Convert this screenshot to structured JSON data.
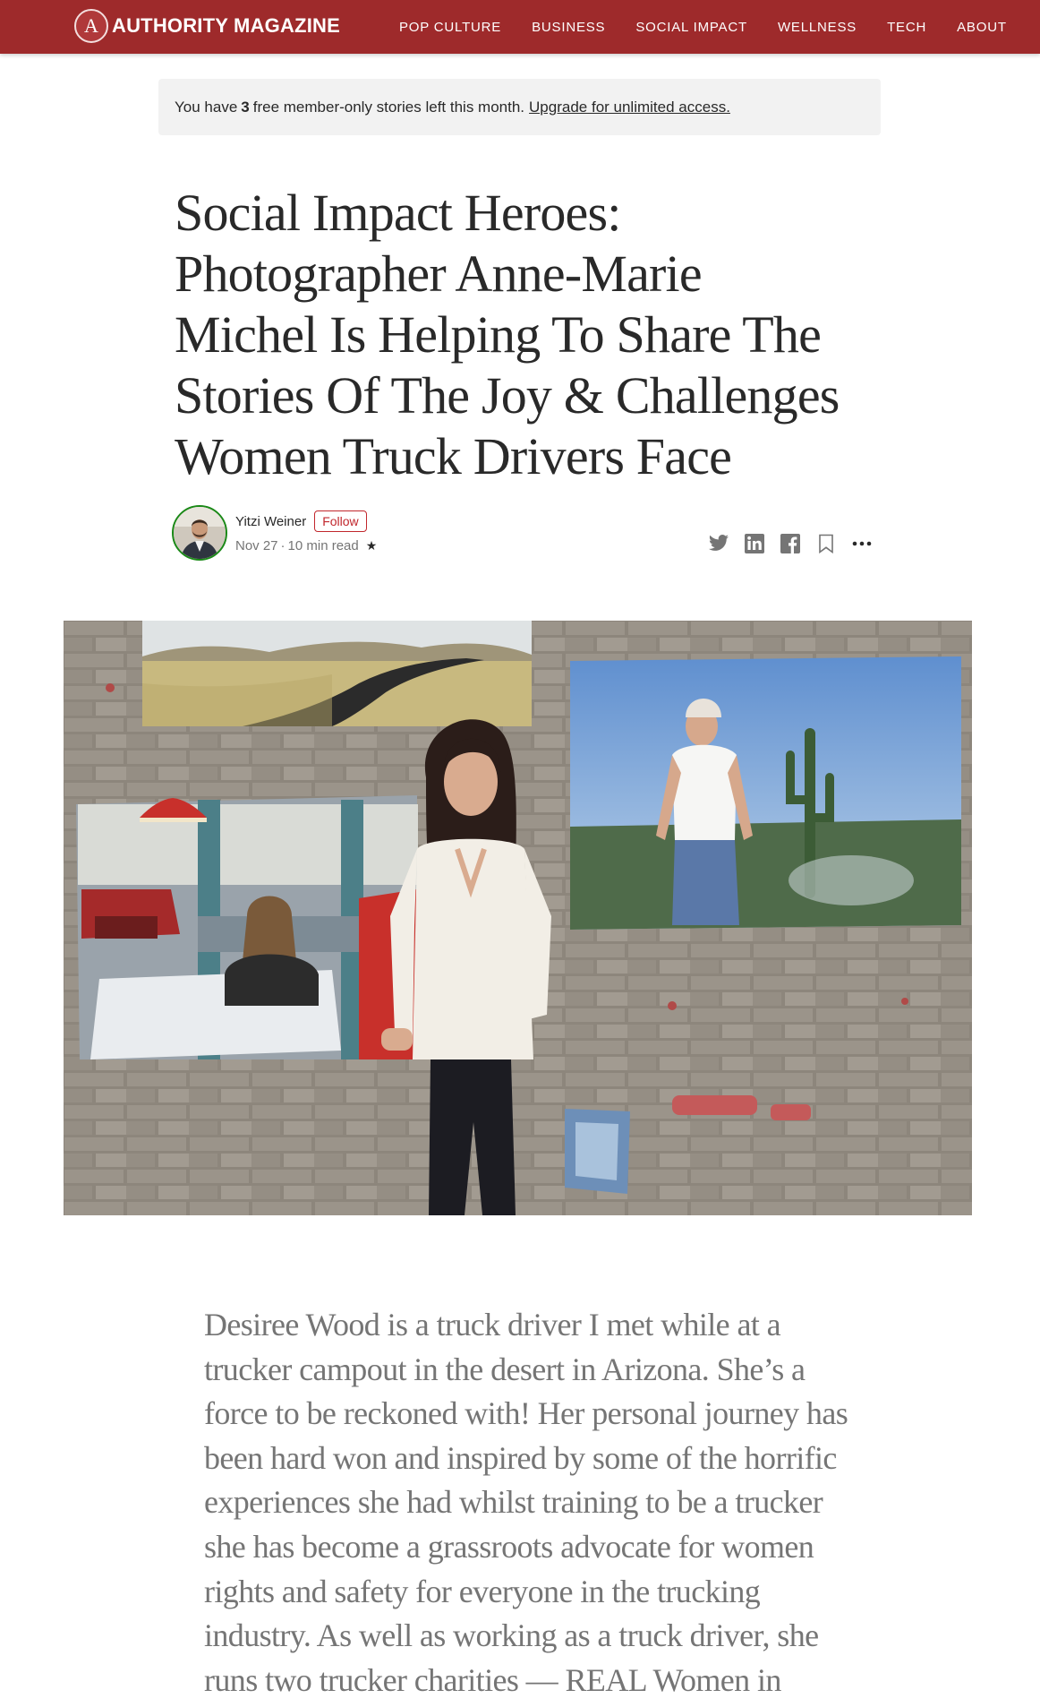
{
  "brand": {
    "logo_letter": "A",
    "name": "AUTHORITY MAGAZINE",
    "color": "#9e2a2b"
  },
  "nav": {
    "items": [
      {
        "label": "POP CULTURE"
      },
      {
        "label": "BUSINESS"
      },
      {
        "label": "SOCIAL IMPACT"
      },
      {
        "label": "WELLNESS"
      },
      {
        "label": "TECH"
      },
      {
        "label": "ABOUT"
      }
    ]
  },
  "banner": {
    "prefix": "You have",
    "count": "3",
    "suffix": "free member-only stories left this month.",
    "link": "Upgrade for unlimited access."
  },
  "article": {
    "title": "Social Impact Heroes: Photographer Anne-Marie Michel Is Helping To Share The Stories Of The Joy & Challenges Women Truck Drivers Face",
    "author": "Yitzi Weiner",
    "follow_label": "Follow",
    "date": "Nov 27",
    "separator": "·",
    "read_time": "10 min read",
    "member_star": "★",
    "share_icons": [
      "twitter-icon",
      "linkedin-icon",
      "facebook-icon",
      "bookmark-icon",
      "more-icon"
    ],
    "body_paragraph": "Desiree Wood is a truck driver I met while at a trucker campout in the desert in Arizona. She’s a force to be reckoned with! Her personal journey has been hard won and inspired by some of the horrific experiences she had whilst training to be a trucker she has become a grassroots advocate for women rights and safety for everyone in the trucking industry. As well as working as a truck driver, she runs two trucker charities — REAL Women in"
  }
}
